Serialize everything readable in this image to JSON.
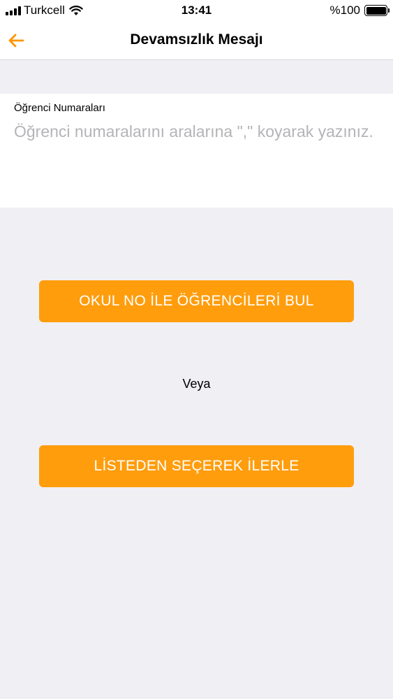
{
  "status_bar": {
    "carrier": "Turkcell",
    "time": "13:41",
    "battery": "%100"
  },
  "nav": {
    "title": "Devamsızlık Mesajı",
    "back_icon": "arrow-left-icon",
    "accent_color": "#ff9500"
  },
  "form": {
    "label": "Öğrenci Numaraları",
    "placeholder": "Öğrenci numaralarını aralarına \",\" koyarak yazınız.",
    "value": ""
  },
  "actions": {
    "find_by_number_label": "OKUL NO İLE ÖĞRENCİLERİ BUL",
    "or_label": "Veya",
    "select_from_list_label": "LİSTEDEN SEÇEREK İLERLE",
    "button_color": "#ff9d0d"
  }
}
